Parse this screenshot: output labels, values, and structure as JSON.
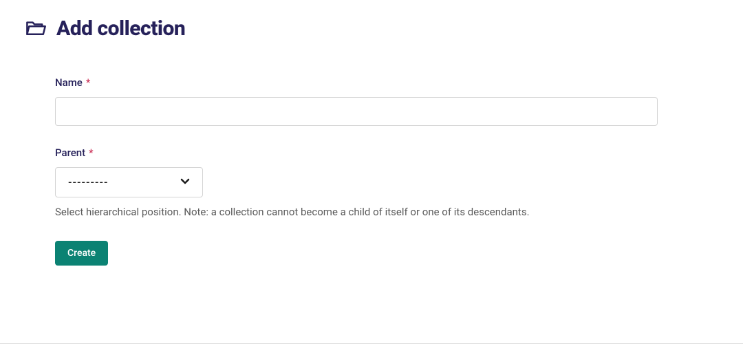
{
  "page": {
    "title": "Add collection"
  },
  "form": {
    "name": {
      "label": "Name",
      "required_symbol": "*",
      "value": ""
    },
    "parent": {
      "label": "Parent",
      "required_symbol": "*",
      "selected": "---------",
      "help_text": "Select hierarchical position. Note: a collection cannot become a child of itself or one of its descendants."
    },
    "submit_label": "Create"
  }
}
